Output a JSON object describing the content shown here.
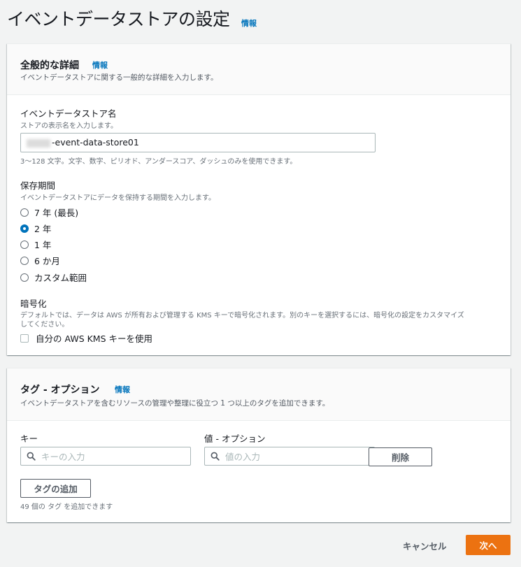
{
  "page": {
    "title": "イベントデータストアの設定",
    "info": "情報"
  },
  "general": {
    "heading": "全般的な詳細",
    "info": "情報",
    "description": "イベントデータストアに関する一般的な詳細を入力します。",
    "name_label": "イベントデータストア名",
    "name_hint": "ストアの表示名を入力します。",
    "name_value": "-event-data-store01",
    "name_constraint": "3～128 文字。文字、数字、ピリオド、アンダースコア、ダッシュのみを使用できます。",
    "retention_label": "保存期間",
    "retention_hint": "イベントデータストアにデータを保持する期間を入力します。",
    "retention_options": [
      {
        "label": "7 年 (最長)",
        "checked": false
      },
      {
        "label": "2 年",
        "checked": true
      },
      {
        "label": "1 年",
        "checked": false
      },
      {
        "label": "6 か月",
        "checked": false
      },
      {
        "label": "カスタム範囲",
        "checked": false
      }
    ],
    "encryption_label": "暗号化",
    "encryption_hint_1": "デフォルトでは、データは AWS が所有および管理する KMS キーで暗号化されます。別のキーを選択するには、暗号化の設定をカスタマイズ",
    "encryption_hint_2": "してください。",
    "kms_checkbox_label": "自分の AWS KMS キーを使用"
  },
  "tags": {
    "heading": "タグ - オプション",
    "info": "情報",
    "description": "イベントデータストアを含むリソースの管理や整理に役立つ 1 つ以上のタグを追加できます。",
    "key_label": "キー",
    "value_label": "値 - オプション",
    "key_placeholder": "キーの入力",
    "value_placeholder": "値の入力",
    "remove_button": "削除",
    "add_button": "タグの追加",
    "remaining_hint": "49 個の タグ を追加できます"
  },
  "footer": {
    "cancel": "キャンセル",
    "next": "次へ"
  },
  "icons": {
    "search": "search-icon"
  },
  "colors": {
    "accent": "#0073bb",
    "primary_button": "#ec7211",
    "background": "#f2f3f3"
  }
}
